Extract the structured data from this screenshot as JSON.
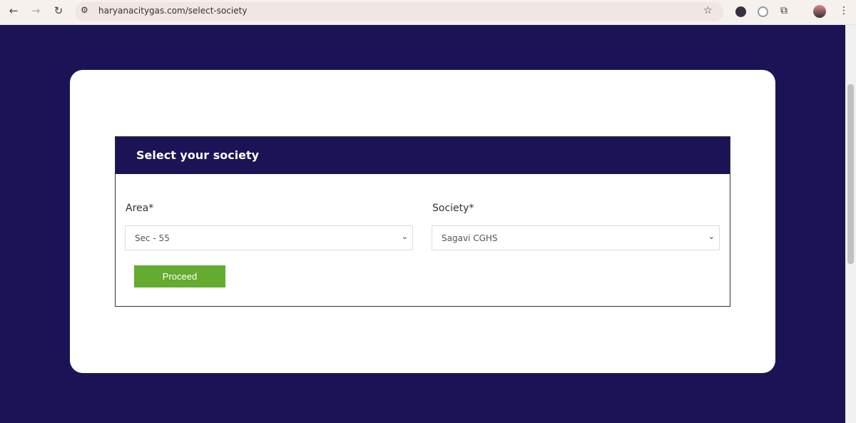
{
  "browser": {
    "url": "haryanacitygas.com/select-society"
  },
  "form": {
    "title": "Select your society",
    "area_label": "Area*",
    "area_value": "Sec - 55",
    "society_label": "Society*",
    "society_value": "Sagavi CGHS",
    "proceed_label": "Proceed"
  },
  "colors": {
    "brand": "#1a1456",
    "button": "#63ac2f"
  }
}
